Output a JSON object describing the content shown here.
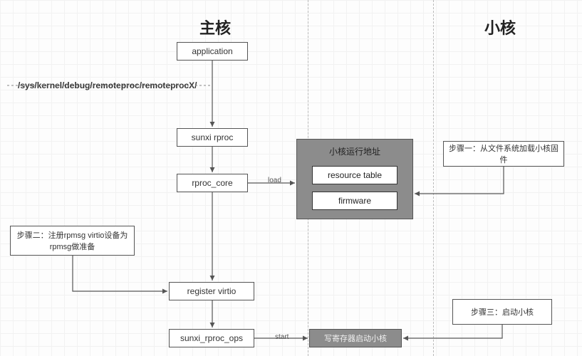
{
  "headings": {
    "main": "主核",
    "minor": "小核"
  },
  "path_text": "/sys/kernel/debug/remoteproc/remoteprocX/",
  "nodes": {
    "application": "application",
    "sunxi_rproc": "sunxi rproc",
    "rproc_core": "rproc_core",
    "register_virtio": "register virtio",
    "sunxi_rproc_ops": "sunxi_rproc_ops"
  },
  "mem_region": {
    "title": "小核运行地址",
    "resource_table": "resource table",
    "firmware": "firmware"
  },
  "start_box": "写寄存器启动小核",
  "annotations": {
    "step1": "步骤一：从文件系统加载小核固件",
    "step2": "步骤二：注册rpmsg virtio设备为rpmsg做准备",
    "step3": "步骤三：启动小核"
  },
  "edge_labels": {
    "load": "load",
    "start": "start"
  }
}
